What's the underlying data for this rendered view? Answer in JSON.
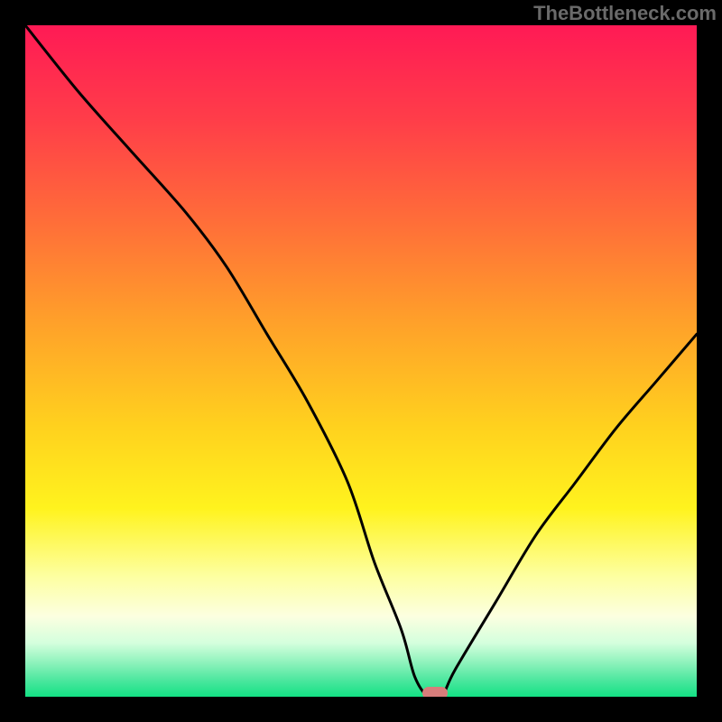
{
  "watermark": "TheBottleneck.com",
  "chart_data": {
    "type": "line",
    "title": "",
    "xlabel": "",
    "ylabel": "",
    "xlim": [
      0,
      100
    ],
    "ylim": [
      0,
      100
    ],
    "grid": false,
    "series": [
      {
        "name": "bottleneck-curve",
        "x": [
          0,
          8,
          16,
          24,
          30,
          36,
          42,
          48,
          52,
          56,
          58,
          60,
          62,
          64,
          70,
          76,
          82,
          88,
          94,
          100
        ],
        "y": [
          100,
          90,
          81,
          72,
          64,
          54,
          44,
          32,
          20,
          10,
          3,
          0,
          0,
          4,
          14,
          24,
          32,
          40,
          47,
          54
        ]
      }
    ],
    "marker": {
      "x": 61,
      "y": 0
    },
    "gradient_stops": [
      {
        "pos": 0,
        "color": "#ff1a55"
      },
      {
        "pos": 0.14,
        "color": "#ff3d49"
      },
      {
        "pos": 0.3,
        "color": "#ff7038"
      },
      {
        "pos": 0.45,
        "color": "#ffa329"
      },
      {
        "pos": 0.6,
        "color": "#ffd21e"
      },
      {
        "pos": 0.72,
        "color": "#fff31e"
      },
      {
        "pos": 0.82,
        "color": "#fdffa0"
      },
      {
        "pos": 0.88,
        "color": "#fcffe0"
      },
      {
        "pos": 0.92,
        "color": "#d4ffdd"
      },
      {
        "pos": 0.95,
        "color": "#8cf2bb"
      },
      {
        "pos": 0.975,
        "color": "#4de79f"
      },
      {
        "pos": 1.0,
        "color": "#13e184"
      }
    ]
  }
}
